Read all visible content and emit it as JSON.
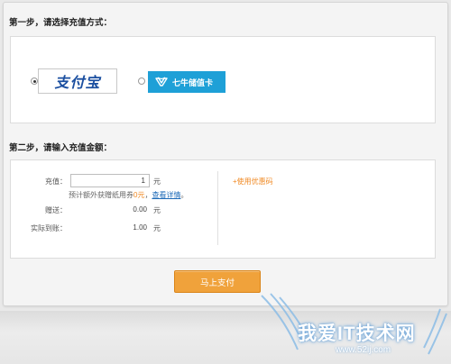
{
  "step1": {
    "title": "第一步，请选择充值方式："
  },
  "payment_methods": [
    {
      "name": "支付宝",
      "selected": true
    },
    {
      "name": "七牛储值卡",
      "selected": false
    }
  ],
  "step2": {
    "title": "第二步，请输入充值金额："
  },
  "form": {
    "recharge_label": "充值：",
    "recharge_value": "1",
    "recharge_unit": "元",
    "hint_prefix": "预计额外获赠纸用券",
    "hint_amount": "0元",
    "hint_sep": "，",
    "hint_link": "查看详情",
    "hint_suffix": "。",
    "bonus_label": "赠送：",
    "bonus_value": "0.00",
    "bonus_unit": "元",
    "actual_label": "实际到账：",
    "actual_value": "1.00",
    "actual_unit": "元",
    "coupon_link": "+使用优惠码"
  },
  "pay_button": {
    "label": "马上支付"
  },
  "watermark": {
    "title": "我爱IT技术网",
    "url": "www.52ij.com"
  },
  "colors": {
    "accent_orange": "#f0a23b",
    "link_blue": "#1e6bb8",
    "qiniu_blue": "#1ea0d7",
    "alipay_blue": "#1b4fa0"
  }
}
